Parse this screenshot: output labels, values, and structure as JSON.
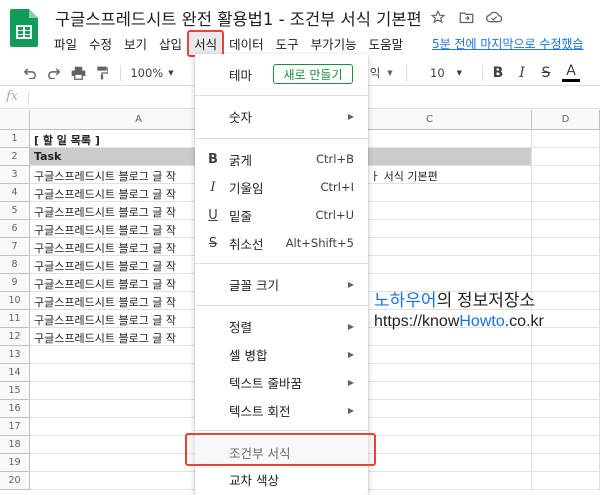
{
  "title": "구글스프레드시트 완전 활용법1 - 조건부 서식 기본편",
  "menu": [
    "파일",
    "수정",
    "보기",
    "삽입",
    "서식",
    "데이터",
    "도구",
    "부가기능",
    "도움말"
  ],
  "last_edit": "5분 전에 마지막으로 수정했습",
  "toolbar": {
    "zoom": "100%",
    "font_partial": "익",
    "font_size": "10",
    "bold": "B",
    "italic": "I",
    "strike": "S",
    "text_color": "A"
  },
  "formula_bar": {
    "fx": "fx"
  },
  "columns": [
    "A",
    "C",
    "D"
  ],
  "rows": [
    {
      "num": "1",
      "a": "[ 할 일 목록 ]",
      "c": ""
    },
    {
      "num": "2",
      "a": "Task",
      "c": ""
    },
    {
      "num": "3",
      "a": "구글스프레드시트 블로그 글 작",
      "c": "ㅏ 서식 기본편"
    },
    {
      "num": "4",
      "a": "구글스프레드시트 블로그 글 작",
      "c": ""
    },
    {
      "num": "5",
      "a": "구글스프레드시트 블로그 글 작",
      "c": ""
    },
    {
      "num": "6",
      "a": "구글스프레드시트 블로그 글 작",
      "c": ""
    },
    {
      "num": "7",
      "a": "구글스프레드시트 블로그 글 작",
      "c": ""
    },
    {
      "num": "8",
      "a": "구글스프레드시트 블로그 글 작",
      "c": ""
    },
    {
      "num": "9",
      "a": "구글스프레드시트 블로그 글 작",
      "c": ""
    },
    {
      "num": "10",
      "a": "구글스프레드시트 블로그 글 작",
      "c": ""
    },
    {
      "num": "11",
      "a": "구글스프레드시트 블로그 글 작",
      "c": ""
    },
    {
      "num": "12",
      "a": "구글스프레드시트 블로그 글 작",
      "c": ""
    },
    {
      "num": "13",
      "a": "",
      "c": ""
    },
    {
      "num": "14",
      "a": "",
      "c": ""
    },
    {
      "num": "15",
      "a": "",
      "c": ""
    },
    {
      "num": "16",
      "a": "",
      "c": ""
    },
    {
      "num": "17",
      "a": "",
      "c": ""
    },
    {
      "num": "18",
      "a": "",
      "c": ""
    },
    {
      "num": "19",
      "a": "",
      "c": ""
    },
    {
      "num": "20",
      "a": "",
      "c": ""
    }
  ],
  "watermark": {
    "name_blue": "노하우어",
    "name_rest": "의 정보저장소",
    "url_pre": "https://know",
    "url_blue": "Howto",
    "url_post": ".co.kr"
  },
  "dropdown": {
    "theme_label": "테마",
    "theme_button": "새로 만들기",
    "number": "숫자",
    "bold": "굵게",
    "bold_shortcut": "Ctrl+B",
    "italic": "기울임",
    "italic_shortcut": "Ctrl+I",
    "underline": "밑줄",
    "underline_shortcut": "Ctrl+U",
    "strike": "취소선",
    "strike_shortcut": "Alt+Shift+5",
    "font_size": "글꼴 크기",
    "align": "정렬",
    "merge": "셀 병합",
    "wrap": "텍스트 줄바꿈",
    "rotate": "텍스트 회전",
    "conditional": "조건부 서식",
    "alternating": "교차 색상"
  },
  "colors": {
    "sheets_green": "#0f9d58",
    "highlight_red": "#ea4335",
    "link_blue": "#1a73e8",
    "header_gray": "#cccccc"
  }
}
